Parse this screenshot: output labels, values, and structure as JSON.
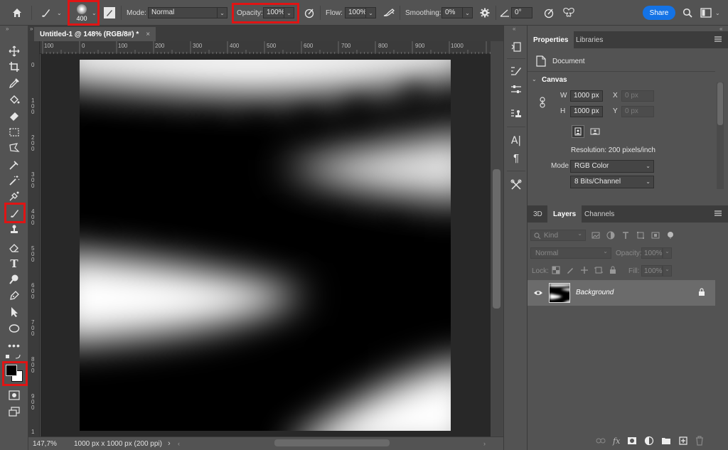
{
  "options_bar": {
    "brush_size": "400",
    "mode_label": "Mode:",
    "mode_value": "Normal",
    "opacity_label": "Opacity:",
    "opacity_value": "100%",
    "flow_label": "Flow:",
    "flow_value": "100%",
    "smoothing_label": "Smoothing:",
    "smoothing_value": "0%",
    "angle_value": "0°",
    "share_label": "Share"
  },
  "document": {
    "tab_title": "Untitled-1 @ 148% (RGB/8#) *",
    "close_glyph": "×",
    "ruler_h_labels": [
      "100",
      "0",
      "100",
      "200",
      "300",
      "400",
      "500",
      "600",
      "700",
      "800",
      "900",
      "1000"
    ],
    "ruler_v_labels": [
      "0",
      "1 0 0",
      "2 0 0",
      "3 0 0",
      "4 0 0",
      "5 0 0",
      "6 0 0",
      "7 0 0",
      "8 0 0",
      "9 0 0",
      "1"
    ]
  },
  "status_bar": {
    "zoom": "147,7%",
    "doc_info": "1000 px x 1000 px (200 ppi)",
    "arrow": "›"
  },
  "properties_panel": {
    "tabs": [
      "Properties",
      "Libraries"
    ],
    "document_label": "Document",
    "canvas_heading": "Canvas",
    "w_label": "W",
    "w_value": "1000 px",
    "h_label": "H",
    "h_value": "1000 px",
    "x_label": "X",
    "x_value": "0 px",
    "y_label": "Y",
    "y_value": "0 px",
    "resolution": "Resolution: 200 pixels/inch",
    "mode_label": "Mode",
    "mode_value": "RGB Color",
    "bits_value": "8 Bits/Channel"
  },
  "layers_panel": {
    "tabs": [
      "3D",
      "Layers",
      "Channels"
    ],
    "kind_placeholder": "Kind",
    "blend_mode": "Normal",
    "opacity_label": "Opacity:",
    "opacity_value": "100%",
    "lock_label": "Lock:",
    "fill_label": "Fill:",
    "fill_value": "100%",
    "layer_name": "Background"
  },
  "colors": {
    "highlight_red": "#e01414",
    "share_blue": "#1473e6",
    "panel_bg": "#535353"
  }
}
